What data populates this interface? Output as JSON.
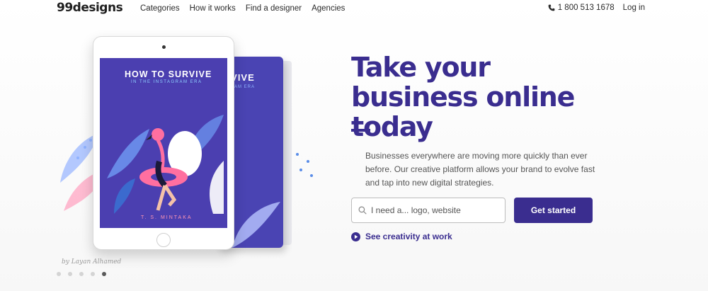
{
  "header": {
    "logo": "99designs",
    "nav": [
      "Categories",
      "How it works",
      "Find a designer",
      "Agencies"
    ],
    "phone": "1 800 513 1678",
    "login": "Log in"
  },
  "hero": {
    "headline": "Take your business online today",
    "description": "Businesses everywhere are moving more quickly than ever before. Our creative platform allows your brand to evolve fast and tap into new digital strategies.",
    "search_placeholder": "I need a... logo, website",
    "cta": "Get started",
    "secondary_link": "See creativity at work"
  },
  "artwork": {
    "screen_title": "HOW TO SURVIVE",
    "screen_subtitle": "IN THE INSTAGRAM ERA",
    "book_title": "RVIVE",
    "book_subtitle": "GRAM ERA",
    "author": "T. S. MINTAKA",
    "credit": "by Layan Alhamed"
  },
  "carousel": {
    "total": 5,
    "active_index": 4
  },
  "colors": {
    "brand": "#3a2d8f",
    "cover": "#4b3fb0",
    "flamingo": "#ff6fa0"
  }
}
